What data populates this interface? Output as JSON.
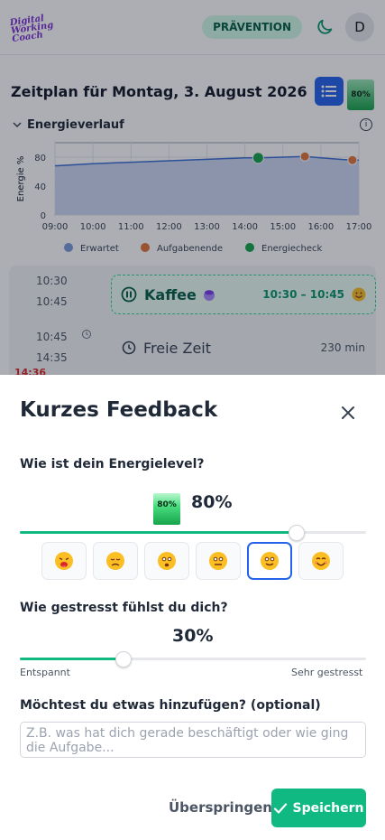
{
  "header": {
    "logo_text": "Digital Working Coach",
    "mode_badge": "PRÄVENTION",
    "avatar_initial": "D",
    "theme_icon": "moon-icon"
  },
  "schedule": {
    "title": "Zeitplan für Montag, 3. August 2026",
    "list_icon": "list-icon",
    "energy_badge": "80%"
  },
  "energy_section": {
    "label": "Energieverlauf",
    "info_icon": "info-icon"
  },
  "chart_data": {
    "type": "line",
    "ylabel": "Energie %",
    "xlabel": "",
    "ylim": [
      0,
      100
    ],
    "yticks": [
      0,
      40,
      80
    ],
    "x_tick_labels": [
      "09:00",
      "10:00",
      "11:00",
      "12:00",
      "13:00",
      "14:00",
      "15:00",
      "16:00",
      "17:00"
    ],
    "series": [
      {
        "name": "Erwartet",
        "type": "area",
        "color": "#9bb1de",
        "points": [
          [
            9.0,
            68
          ],
          [
            10.0,
            71
          ],
          [
            11.0,
            73
          ],
          [
            12.0,
            75
          ],
          [
            13.0,
            77
          ],
          [
            14.0,
            79
          ],
          [
            14.35,
            79
          ],
          [
            15.0,
            80
          ],
          [
            15.58,
            81
          ],
          [
            16.0,
            79
          ],
          [
            16.5,
            77
          ],
          [
            16.83,
            76
          ],
          [
            17.0,
            76
          ]
        ]
      },
      {
        "name": "Aufgabenende",
        "type": "scatter",
        "color": "#e0753a",
        "points": [
          [
            15.58,
            81
          ],
          [
            16.83,
            76
          ]
        ]
      },
      {
        "name": "Energiecheck",
        "type": "scatter",
        "color": "#16a34a",
        "points": [
          [
            14.35,
            79
          ]
        ]
      }
    ],
    "legend": [
      "Erwartet",
      "Aufgabenende",
      "Energiecheck"
    ],
    "legend_position": "bottom",
    "grid": true
  },
  "timeline": {
    "rows": [
      {
        "start": "10:30",
        "end": "10:45"
      },
      {
        "start": "10:45",
        "end": "14:35"
      }
    ],
    "now_label": "14:36",
    "items": [
      {
        "name": "Kaffee",
        "range": "10:30 – 10:45",
        "icon": "pause-icon",
        "mood_icon": "smile-emoji-icon",
        "side_icon": "coffee-cup-icon"
      },
      {
        "name": "Freie Zeit",
        "duration": "230 min",
        "icon": "clock-icon"
      }
    ]
  },
  "feedback": {
    "title": "Kurzes Feedback",
    "close_icon": "close-icon",
    "energy_question": "Wie ist dein Energielevel?",
    "energy_badge": "80%",
    "energy_value": "80%",
    "energy_level": 0.8,
    "moods": [
      {
        "icon": "exhausted-emoji-icon",
        "selected": false
      },
      {
        "icon": "sad-emoji-icon",
        "selected": false
      },
      {
        "icon": "worried-emoji-icon",
        "selected": false
      },
      {
        "icon": "neutral-emoji-icon",
        "selected": false
      },
      {
        "icon": "content-emoji-icon",
        "selected": true
      },
      {
        "icon": "happy-emoji-icon",
        "selected": false
      }
    ],
    "stress_question": "Wie gestresst fühlst du dich?",
    "stress_value": "30%",
    "stress_level": 0.3,
    "stress_min_label": "Entspannt",
    "stress_max_label": "Sehr gestresst",
    "note_question": "Möchtest du etwas hinzufügen? (optional)",
    "note_placeholder": "Z.B. was hat dich gerade beschäftigt oder wie ging die Aufgabe...",
    "note_value": "",
    "skip_label": "Überspringen",
    "save_label": "Speichern",
    "save_icon": "check-icon"
  },
  "colors": {
    "accent": "#10b981",
    "primary": "#2563eb",
    "badge_bg": "#d1fae5"
  }
}
